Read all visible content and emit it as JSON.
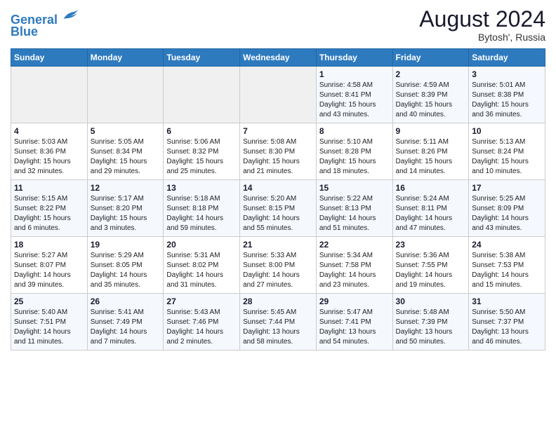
{
  "header": {
    "logo_line1": "General",
    "logo_line2": "Blue",
    "month_year": "August 2024",
    "location": "Bytosh', Russia"
  },
  "weekdays": [
    "Sunday",
    "Monday",
    "Tuesday",
    "Wednesday",
    "Thursday",
    "Friday",
    "Saturday"
  ],
  "weeks": [
    [
      {
        "day": "",
        "info": ""
      },
      {
        "day": "",
        "info": ""
      },
      {
        "day": "",
        "info": ""
      },
      {
        "day": "",
        "info": ""
      },
      {
        "day": "1",
        "info": "Sunrise: 4:58 AM\nSunset: 8:41 PM\nDaylight: 15 hours\nand 43 minutes."
      },
      {
        "day": "2",
        "info": "Sunrise: 4:59 AM\nSunset: 8:39 PM\nDaylight: 15 hours\nand 40 minutes."
      },
      {
        "day": "3",
        "info": "Sunrise: 5:01 AM\nSunset: 8:38 PM\nDaylight: 15 hours\nand 36 minutes."
      }
    ],
    [
      {
        "day": "4",
        "info": "Sunrise: 5:03 AM\nSunset: 8:36 PM\nDaylight: 15 hours\nand 32 minutes."
      },
      {
        "day": "5",
        "info": "Sunrise: 5:05 AM\nSunset: 8:34 PM\nDaylight: 15 hours\nand 29 minutes."
      },
      {
        "day": "6",
        "info": "Sunrise: 5:06 AM\nSunset: 8:32 PM\nDaylight: 15 hours\nand 25 minutes."
      },
      {
        "day": "7",
        "info": "Sunrise: 5:08 AM\nSunset: 8:30 PM\nDaylight: 15 hours\nand 21 minutes."
      },
      {
        "day": "8",
        "info": "Sunrise: 5:10 AM\nSunset: 8:28 PM\nDaylight: 15 hours\nand 18 minutes."
      },
      {
        "day": "9",
        "info": "Sunrise: 5:11 AM\nSunset: 8:26 PM\nDaylight: 15 hours\nand 14 minutes."
      },
      {
        "day": "10",
        "info": "Sunrise: 5:13 AM\nSunset: 8:24 PM\nDaylight: 15 hours\nand 10 minutes."
      }
    ],
    [
      {
        "day": "11",
        "info": "Sunrise: 5:15 AM\nSunset: 8:22 PM\nDaylight: 15 hours\nand 6 minutes."
      },
      {
        "day": "12",
        "info": "Sunrise: 5:17 AM\nSunset: 8:20 PM\nDaylight: 15 hours\nand 3 minutes."
      },
      {
        "day": "13",
        "info": "Sunrise: 5:18 AM\nSunset: 8:18 PM\nDaylight: 14 hours\nand 59 minutes."
      },
      {
        "day": "14",
        "info": "Sunrise: 5:20 AM\nSunset: 8:15 PM\nDaylight: 14 hours\nand 55 minutes."
      },
      {
        "day": "15",
        "info": "Sunrise: 5:22 AM\nSunset: 8:13 PM\nDaylight: 14 hours\nand 51 minutes."
      },
      {
        "day": "16",
        "info": "Sunrise: 5:24 AM\nSunset: 8:11 PM\nDaylight: 14 hours\nand 47 minutes."
      },
      {
        "day": "17",
        "info": "Sunrise: 5:25 AM\nSunset: 8:09 PM\nDaylight: 14 hours\nand 43 minutes."
      }
    ],
    [
      {
        "day": "18",
        "info": "Sunrise: 5:27 AM\nSunset: 8:07 PM\nDaylight: 14 hours\nand 39 minutes."
      },
      {
        "day": "19",
        "info": "Sunrise: 5:29 AM\nSunset: 8:05 PM\nDaylight: 14 hours\nand 35 minutes."
      },
      {
        "day": "20",
        "info": "Sunrise: 5:31 AM\nSunset: 8:02 PM\nDaylight: 14 hours\nand 31 minutes."
      },
      {
        "day": "21",
        "info": "Sunrise: 5:33 AM\nSunset: 8:00 PM\nDaylight: 14 hours\nand 27 minutes."
      },
      {
        "day": "22",
        "info": "Sunrise: 5:34 AM\nSunset: 7:58 PM\nDaylight: 14 hours\nand 23 minutes."
      },
      {
        "day": "23",
        "info": "Sunrise: 5:36 AM\nSunset: 7:55 PM\nDaylight: 14 hours\nand 19 minutes."
      },
      {
        "day": "24",
        "info": "Sunrise: 5:38 AM\nSunset: 7:53 PM\nDaylight: 14 hours\nand 15 minutes."
      }
    ],
    [
      {
        "day": "25",
        "info": "Sunrise: 5:40 AM\nSunset: 7:51 PM\nDaylight: 14 hours\nand 11 minutes."
      },
      {
        "day": "26",
        "info": "Sunrise: 5:41 AM\nSunset: 7:49 PM\nDaylight: 14 hours\nand 7 minutes."
      },
      {
        "day": "27",
        "info": "Sunrise: 5:43 AM\nSunset: 7:46 PM\nDaylight: 14 hours\nand 2 minutes."
      },
      {
        "day": "28",
        "info": "Sunrise: 5:45 AM\nSunset: 7:44 PM\nDaylight: 13 hours\nand 58 minutes."
      },
      {
        "day": "29",
        "info": "Sunrise: 5:47 AM\nSunset: 7:41 PM\nDaylight: 13 hours\nand 54 minutes."
      },
      {
        "day": "30",
        "info": "Sunrise: 5:48 AM\nSunset: 7:39 PM\nDaylight: 13 hours\nand 50 minutes."
      },
      {
        "day": "31",
        "info": "Sunrise: 5:50 AM\nSunset: 7:37 PM\nDaylight: 13 hours\nand 46 minutes."
      }
    ]
  ]
}
